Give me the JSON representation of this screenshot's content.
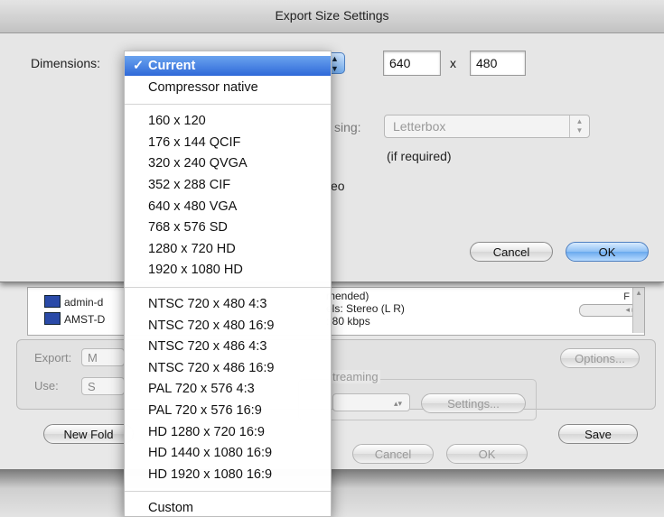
{
  "sheet": {
    "title": "Export Size Settings",
    "dimensions_label": "Dimensions:",
    "width_value": "640",
    "times": "x",
    "height_value": "480",
    "resize_label_partial": "sing:",
    "resize_value": "Letterbox",
    "if_required": "(if required)",
    "partial_text": "eo",
    "cancel_label": "Cancel",
    "ok_label": "OK"
  },
  "menu": {
    "check_glyph": "✓",
    "selected": "Current",
    "groups": [
      [
        "Current",
        "Compressor native"
      ],
      [
        "160 x 120",
        "176 x 144 QCIF",
        "320 x 240 QVGA",
        "352 x 288 CIF",
        "640 x 480 VGA",
        "768 x 576 SD",
        "1280 x 720 HD",
        "1920 x 1080 HD"
      ],
      [
        "NTSC 720 x 480 4:3",
        "NTSC 720 x 480 16:9",
        "NTSC 720 x 486 4:3",
        "NTSC 720 x 486 16:9",
        "PAL 720 x 576 4:3",
        "PAL 720 x 576 16:9",
        "HD 1280 x 720 16:9",
        "HD 1440 x 1080 16:9",
        "HD 1920 x 1080 16:9"
      ],
      [
        "Custom"
      ]
    ]
  },
  "background_dialog": {
    "file1": "admin-d",
    "file2": "AMST-D",
    "info1": "mended)",
    "info2": "els: Stereo (L R)",
    "info3": ": 80 kbps",
    "export_label": "Export:",
    "export_value": "M",
    "use_label": "Use:",
    "use_value": "S",
    "streaming_legend": "treaming",
    "settings_label": "Settings...",
    "options_label": "Options...",
    "new_folder_label": "New Fold",
    "cancel_label": "Cancel",
    "ok_label": "OK",
    "save_label": "Save",
    "scroll_v_label": "F"
  }
}
